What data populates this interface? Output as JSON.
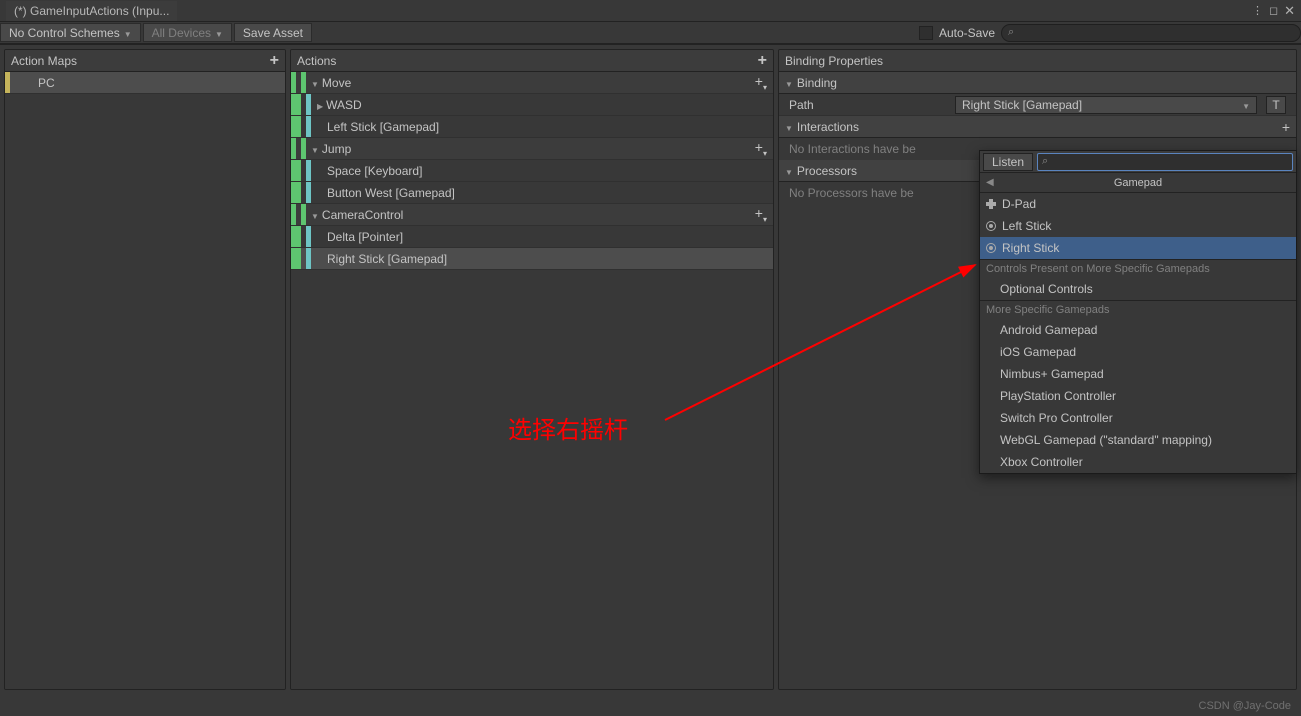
{
  "window": {
    "title": "(*) GameInputActions (Inpu..."
  },
  "toolbar": {
    "control_schemes": "No Control Schemes",
    "devices": "All Devices",
    "save_asset": "Save Asset",
    "auto_save": "Auto-Save"
  },
  "panels": {
    "action_maps": {
      "title": "Action Maps",
      "items": [
        "PC"
      ]
    },
    "actions": {
      "title": "Actions",
      "tree": [
        {
          "name": "Move",
          "bindings": [
            {
              "label": "WASD",
              "composite": true
            },
            {
              "label": "Left Stick [Gamepad]"
            }
          ]
        },
        {
          "name": "Jump",
          "bindings": [
            {
              "label": "Space [Keyboard]"
            },
            {
              "label": "Button West [Gamepad]"
            }
          ]
        },
        {
          "name": "CameraControl",
          "bindings": [
            {
              "label": "Delta [Pointer]"
            },
            {
              "label": "Right Stick [Gamepad]",
              "selected": true
            }
          ]
        }
      ]
    },
    "props": {
      "title": "Binding Properties",
      "binding_section": "Binding",
      "path_label": "Path",
      "path_value": "Right Stick [Gamepad]",
      "t_button": "T",
      "interactions_section": "Interactions",
      "interactions_empty": "No Interactions have be",
      "processors_section": "Processors",
      "processors_empty": "No Processors have be"
    }
  },
  "popup": {
    "listen": "Listen",
    "crumb": "Gamepad",
    "items_main": [
      {
        "label": "D-Pad",
        "icon": "dpad"
      },
      {
        "label": "Left Stick",
        "icon": "stick"
      },
      {
        "label": "Right Stick",
        "icon": "stick",
        "selected": true
      }
    ],
    "group1_title": "Controls Present on More Specific Gamepads",
    "group1_items": [
      "Optional Controls"
    ],
    "group2_title": "More Specific Gamepads",
    "group2_items": [
      "Android Gamepad",
      "iOS Gamepad",
      "Nimbus+ Gamepad",
      "PlayStation Controller",
      "Switch Pro Controller",
      "WebGL Gamepad (\"standard\" mapping)",
      "Xbox Controller"
    ]
  },
  "annotation": {
    "text": "选择右摇杆"
  },
  "watermark": "CSDN @Jay-Code"
}
